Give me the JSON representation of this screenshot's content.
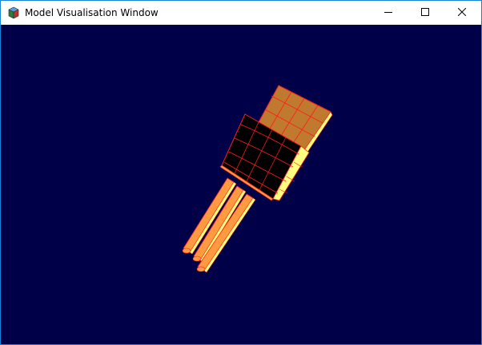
{
  "window": {
    "title": "Model Visualisation Window",
    "border_color": "#1883d7"
  },
  "titlebar": {
    "app_icon": "cube-icon",
    "minimize_icon": "minimize-icon",
    "maximize_icon": "maximize-icon",
    "close_icon": "close-icon"
  },
  "viewport": {
    "background": "#000048",
    "model": {
      "icon": "transistor-3d-model",
      "body_color": "#000000",
      "tab_color": "#c07a30",
      "lead_color": "#ff9a40",
      "highlight_color": "#ffff80",
      "wire_color": "#ff1a1a"
    }
  }
}
